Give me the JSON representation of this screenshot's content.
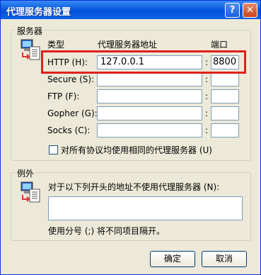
{
  "window": {
    "title": "代理服务器设置",
    "help_glyph": "?",
    "close_glyph": "✕"
  },
  "servers": {
    "group_label": "服务器",
    "col_type": "类型",
    "col_address": "代理服务器地址",
    "col_port": "端口",
    "rows": [
      {
        "label": "HTTP (H):",
        "address": "127.0.0.1",
        "port": "8800"
      },
      {
        "label": "Secure (S):",
        "address": "",
        "port": ""
      },
      {
        "label": "FTP (F):",
        "address": "",
        "port": ""
      },
      {
        "label": "Gopher (G):",
        "address": "",
        "port": ""
      },
      {
        "label": "Socks (C):",
        "address": "",
        "port": ""
      }
    ],
    "colon": ":",
    "same_proxy_label": "对所有协议均使用相同的代理服务器 (U)",
    "same_proxy_checked": false,
    "highlight_color": "#e0201c"
  },
  "exceptions": {
    "group_label": "例外",
    "description": "对于以下列开头的地址不使用代理服务器 (N):",
    "value": "",
    "hint": "使用分号 (;) 将不同项目隔开。"
  },
  "buttons": {
    "ok": "确定",
    "cancel": "取消"
  },
  "icons": {
    "servers_icon": "network-computer-icon",
    "exceptions_icon": "network-computer-icon"
  }
}
